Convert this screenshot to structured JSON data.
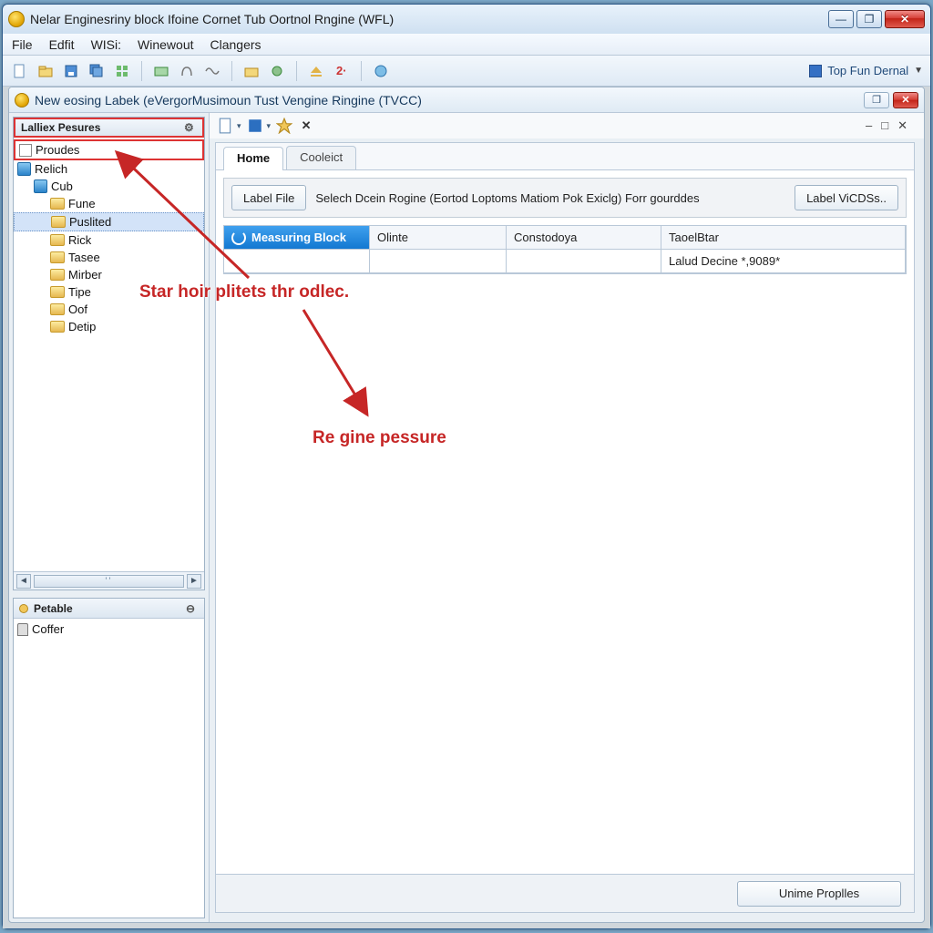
{
  "window": {
    "title": "Nelar Enginesriny block Ifoine Cornet Tub Oortnol Rngine (WFL)"
  },
  "menubar": [
    "File",
    "Edfit",
    "WISi:",
    "Winewout",
    "Clangers"
  ],
  "toolbar_right": "Top Fun Dernal",
  "subwindow": {
    "title": "New eosing Labek (eVergorMusimoun Tust Vengine Ringine (TVCC)"
  },
  "left_panel1": {
    "title": "Lalliex Pesures",
    "items": [
      {
        "label": "Proudes",
        "icon": "note",
        "highlighted": true,
        "indent": 0
      },
      {
        "label": "Relich",
        "icon": "node",
        "indent": 0
      },
      {
        "label": "Cub",
        "icon": "node",
        "indent": 1
      },
      {
        "label": "Fune",
        "icon": "folder",
        "indent": 2
      },
      {
        "label": "Puslited",
        "icon": "folder",
        "indent": 2,
        "selected": true
      },
      {
        "label": "Rick",
        "icon": "folder",
        "indent": 2
      },
      {
        "label": "Tasee",
        "icon": "folder",
        "indent": 2
      },
      {
        "label": "Mirber",
        "icon": "folder",
        "indent": 2
      },
      {
        "label": "Tipe",
        "icon": "folder",
        "indent": 2
      },
      {
        "label": "Oof",
        "icon": "folder",
        "indent": 2
      },
      {
        "label": "Detip",
        "icon": "folder",
        "indent": 2
      }
    ]
  },
  "left_panel2": {
    "title": "Petable",
    "items": [
      {
        "label": "Coffer",
        "icon": "lock"
      }
    ]
  },
  "tabs": [
    {
      "label": "Home",
      "active": true
    },
    {
      "label": "Cooleict",
      "active": false
    }
  ],
  "toolbar_row": {
    "btn_left": "Label File",
    "desc": "Selech Dcein Rogine (Eortod Loptoms Matiom Pok Exiclg) Forr gourddes",
    "btn_right": "Label ViCDSs.."
  },
  "table": {
    "headers": [
      "Measuring Block",
      "Olinte",
      "Constodoya",
      "TaoelBtar"
    ],
    "row": [
      "",
      "",
      "",
      "Lalud Decine *,9089*"
    ]
  },
  "footer_button": "Unime Proplles",
  "annotations": {
    "text1": "Star hoir plitets thr odlec.",
    "text2": "Re gine pessure"
  }
}
